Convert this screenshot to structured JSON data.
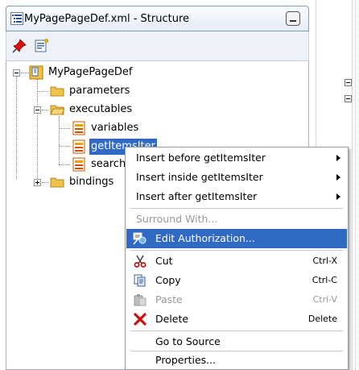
{
  "panel": {
    "title": "MyPagePageDef.xml - Structure"
  },
  "tree": {
    "root": "MyPagePageDef",
    "parameters": "parameters",
    "executables": "executables",
    "variables": "variables",
    "getItemsIter": "getItemsIter",
    "search": "search",
    "bindings": "bindings"
  },
  "context_menu": {
    "insert_before": "Insert before getItemsIter",
    "insert_inside": "Insert inside getItemsIter",
    "insert_after": "Insert after getItemsIter",
    "surround_with": "Surround With...",
    "edit_authorization": "Edit Authorization...",
    "cut": "Cut",
    "cut_shortcut": "Ctrl-X",
    "copy": "Copy",
    "copy_shortcut": "Ctrl-C",
    "paste": "Paste",
    "paste_shortcut": "Ctrl-V",
    "delete": "Delete",
    "delete_shortcut": "Delete",
    "go_to_source": "Go to Source",
    "properties": "Properties..."
  },
  "colors": {
    "selection": "#316ac5",
    "folder": "#f0c24a",
    "disabled_text": "#9a9a9a"
  }
}
